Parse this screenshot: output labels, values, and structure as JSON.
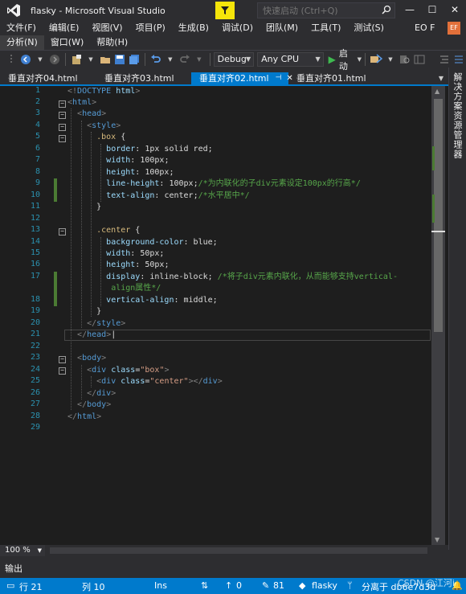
{
  "window": {
    "title": "flasky - Microsoft Visual Studio",
    "quick_launch_placeholder": "快速启动 (Ctrl+Q)",
    "account": "EO F",
    "avatar_initials": "EF"
  },
  "menu": {
    "row1": [
      "文件(F)",
      "编辑(E)",
      "视图(V)",
      "项目(P)",
      "生成(B)",
      "调试(D)",
      "团队(M)",
      "工具(T)",
      "测试(S)"
    ],
    "row2": [
      "分析(N)",
      "窗口(W)",
      "帮助(H)"
    ]
  },
  "toolbar": {
    "config": "Debug",
    "platform": "Any CPU",
    "start": "启动"
  },
  "tabs": [
    {
      "label": "垂直对齐04.html",
      "active": false
    },
    {
      "label": "垂直对齐03.html",
      "active": false
    },
    {
      "label": "垂直对齐02.html",
      "active": true
    },
    {
      "label": "垂直对齐01.html",
      "active": false
    }
  ],
  "side_panel_label": "解决方案资源管理器",
  "editor": {
    "lines": [
      "1",
      "2",
      "3",
      "4",
      "5",
      "6",
      "7",
      "8",
      "9",
      "10",
      "11",
      "12",
      "13",
      "14",
      "15",
      "16",
      "17",
      "18",
      "19",
      "20",
      "21",
      "22",
      "23",
      "24",
      "25",
      "26",
      "27",
      "28",
      "29"
    ]
  },
  "zoom": "100 %",
  "output_label": "输出",
  "status": {
    "line": "行 21",
    "col": "列 10",
    "ins": "Ins",
    "up": "0",
    "changes": "81",
    "repo": "flasky",
    "branch": "分离于 db6e7d3d"
  },
  "watermark": "CSDN @江河i",
  "colors": {
    "accent": "#007acc",
    "background": "#1e1e1e",
    "chrome": "#2d2d30"
  }
}
